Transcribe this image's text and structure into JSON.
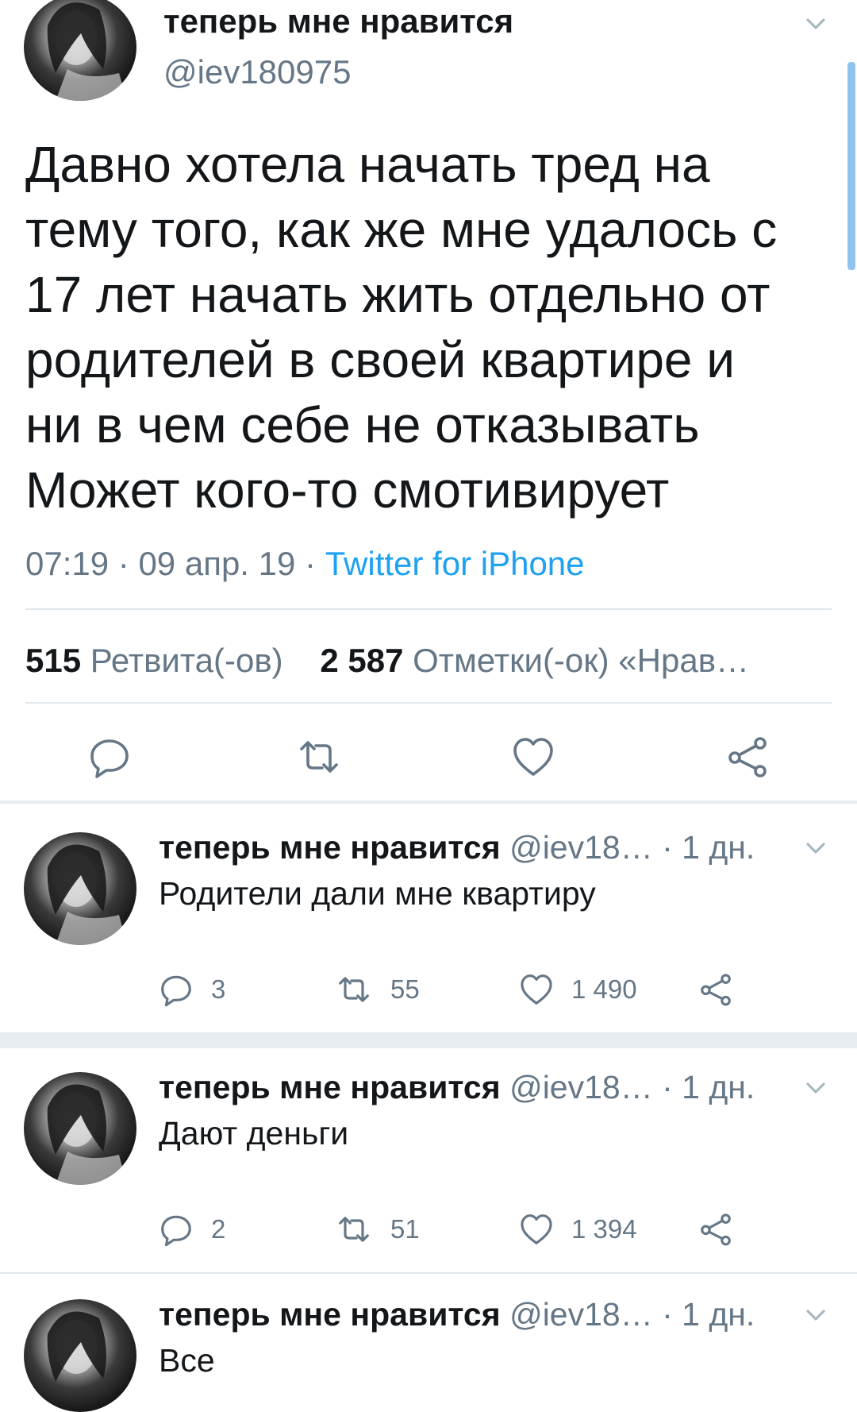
{
  "main_tweet": {
    "author_name": "теперь мне нравится",
    "handle": "@iev180975",
    "text_lines": [
      "Давно хотела начать тред на",
      "тему того, как же мне удалось с",
      "17 лет начать жить отдельно от",
      "родителей в своей квартире и",
      "ни в чем себе не отказывать",
      "Может кого-то смотивирует"
    ],
    "time": "07:19",
    "date": "09 апр. 19",
    "separator": "·",
    "source": "Twitter for iPhone",
    "retweets_count": "515",
    "retweets_label": "Ретвита(-ов)",
    "likes_count": "2 587",
    "likes_label": "Отметки(-ок) «Нрав…",
    "actions": {
      "reply_icon": "reply-icon",
      "retweet_icon": "retweet-icon",
      "like_icon": "heart-icon",
      "share_icon": "share-icon"
    }
  },
  "replies": [
    {
      "author_name": "теперь мне нравится",
      "handle": "@iev18…",
      "time": "· 1 дн.",
      "text": "Родители дали мне квартиру",
      "reply_count": "3",
      "retweet_count": "55",
      "like_count": "1 490"
    },
    {
      "author_name": "теперь мне нравится",
      "handle": "@iev18…",
      "time": "· 1 дн.",
      "text": "Дают деньги",
      "reply_count": "2",
      "retweet_count": "51",
      "like_count": "1 394"
    },
    {
      "author_name": "теперь мне нравится",
      "handle": "@iev18…",
      "time": "· 1 дн.",
      "text": "Все"
    }
  ],
  "colors": {
    "link": "#1da1f2",
    "secondary_text": "#657786",
    "primary_text": "#14171a",
    "divider": "#e1e8ed",
    "separator_band": "#e6ecf0",
    "scroll_indicator": "#8ec4ef"
  }
}
